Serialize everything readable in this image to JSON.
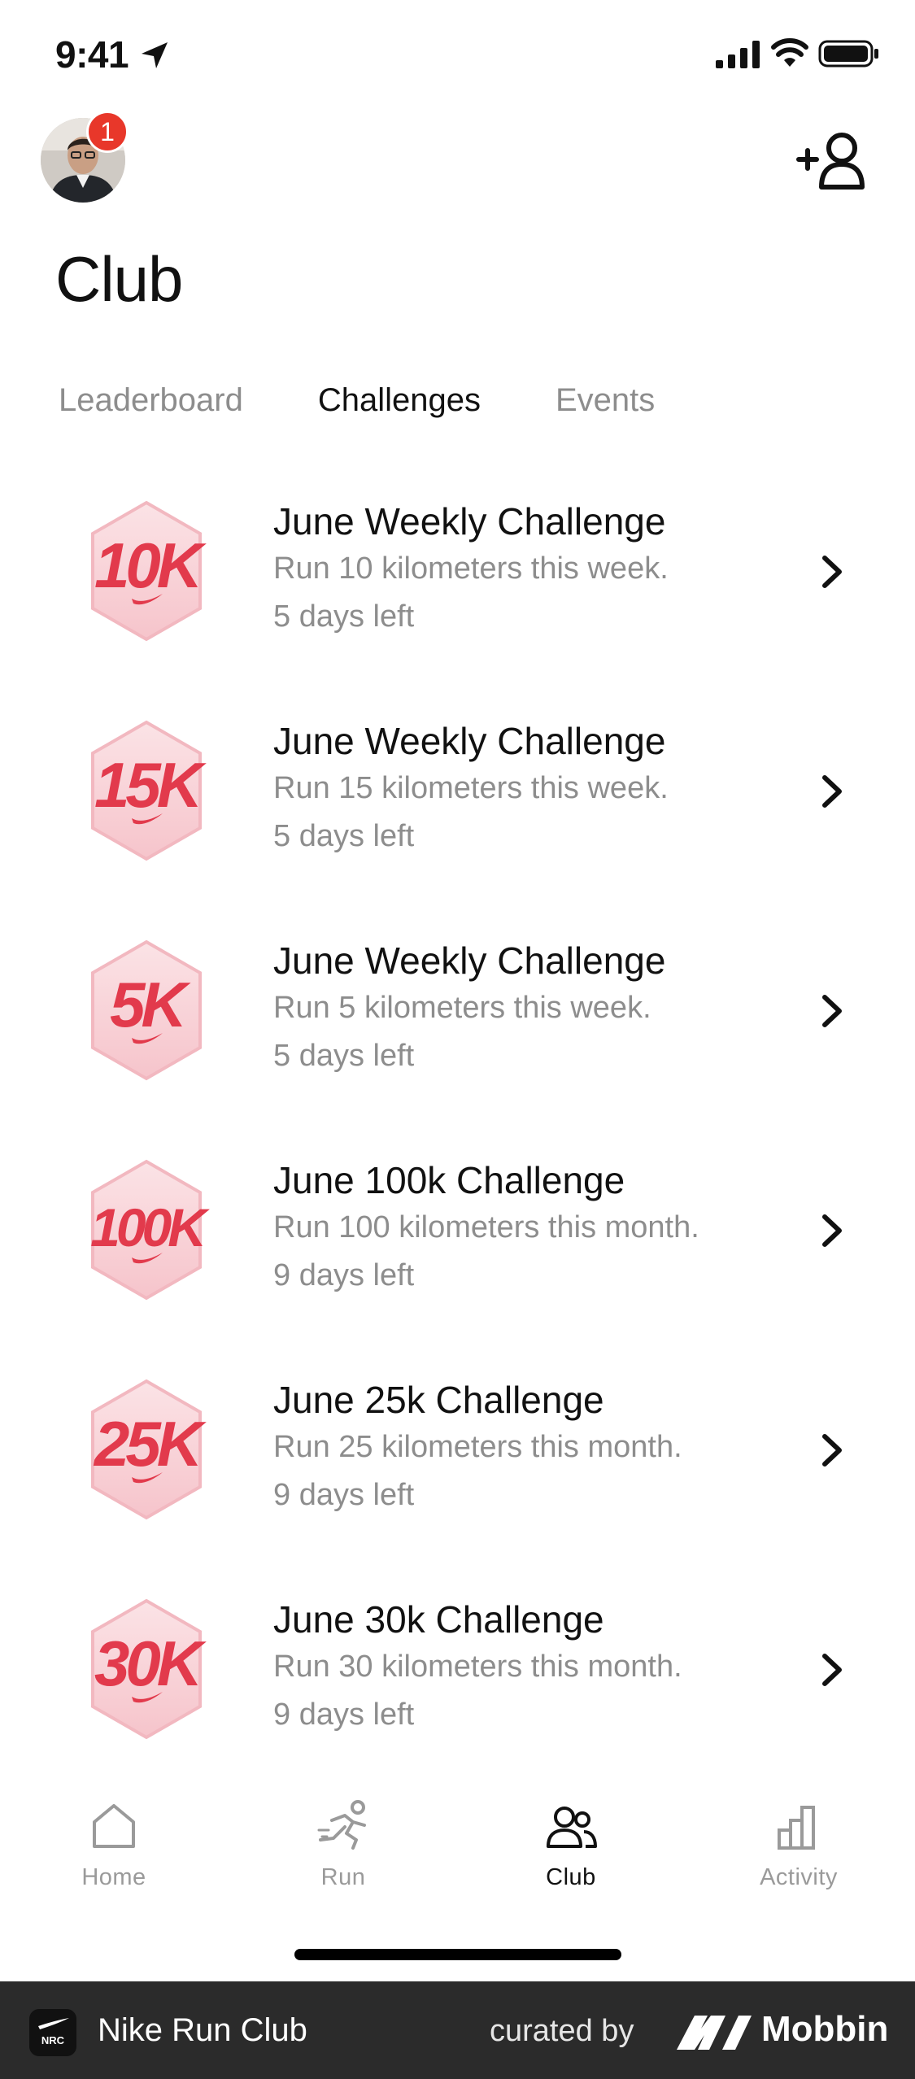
{
  "status_bar": {
    "time": "9:41"
  },
  "header": {
    "title": "Club",
    "notification_count": "1"
  },
  "tabs": [
    {
      "label": "Leaderboard",
      "active": false
    },
    {
      "label": "Challenges",
      "active": true
    },
    {
      "label": "Events",
      "active": false
    }
  ],
  "challenges": [
    {
      "badge": "10K",
      "title": "June Weekly Challenge",
      "description": "Run 10 kilometers this week.",
      "time_left": "5 days left"
    },
    {
      "badge": "15K",
      "title": "June Weekly Challenge",
      "description": "Run 15 kilometers this week.",
      "time_left": "5 days left"
    },
    {
      "badge": "5K",
      "title": "June Weekly Challenge",
      "description": "Run 5 kilometers this week.",
      "time_left": "5 days left"
    },
    {
      "badge": "100K",
      "title": "June 100k Challenge",
      "description": "Run 100 kilometers this month.",
      "time_left": "9 days left"
    },
    {
      "badge": "25K",
      "title": "June 25k Challenge",
      "description": "Run 25 kilometers this month.",
      "time_left": "9 days left"
    },
    {
      "badge": "30K",
      "title": "June 30k Challenge",
      "description": "Run 30 kilometers this month.",
      "time_left": "9 days left"
    }
  ],
  "tabbar": [
    {
      "label": "Home",
      "icon": "home-icon",
      "active": false
    },
    {
      "label": "Run",
      "icon": "run-icon",
      "active": false
    },
    {
      "label": "Club",
      "icon": "club-icon",
      "active": true
    },
    {
      "label": "Activity",
      "icon": "activity-icon",
      "active": false
    }
  ],
  "footer": {
    "logo_text": "NRC",
    "app_name": "Nike Run Club",
    "curated_by": "curated by",
    "brand": "Mobbin"
  },
  "colors": {
    "accent_red": "#e8372a",
    "medal_red": "#e23a4c",
    "inactive": "#8d8d8d",
    "footer_bg": "#2b2b2b"
  }
}
